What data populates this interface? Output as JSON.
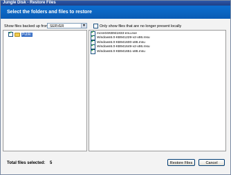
{
  "window": {
    "title": "Jungle Disk - Restore Files"
  },
  "header": {
    "title": "Select the folders and files to restore"
  },
  "backup_source": {
    "label": "Show files backed up from:",
    "selected": "SERVER"
  },
  "filter": {
    "only_show_label": "Only show files that are no longer present locally",
    "checked": false
  },
  "tree": {
    "items": [
      {
        "label": "Public",
        "checked": true
      }
    ]
  },
  "files": {
    "items": [
      {
        "name": "mcsn04KB941833-enu.exe",
        "checked": true
      },
      {
        "name": "Windows6.0-KB941229-v2-x86.msu",
        "checked": true
      },
      {
        "name": "Windows6.0-KB941600-x86.msu",
        "checked": true
      },
      {
        "name": "Windows6.0-KB941649-v2-x86.msu",
        "checked": true
      },
      {
        "name": "Windows6.0-KB941651-x86.msu",
        "checked": true
      }
    ]
  },
  "footer": {
    "total_label": "Total files selected:",
    "total_value": "5"
  },
  "buttons": {
    "restore": "Restore Files",
    "cancel": "Cancel"
  }
}
